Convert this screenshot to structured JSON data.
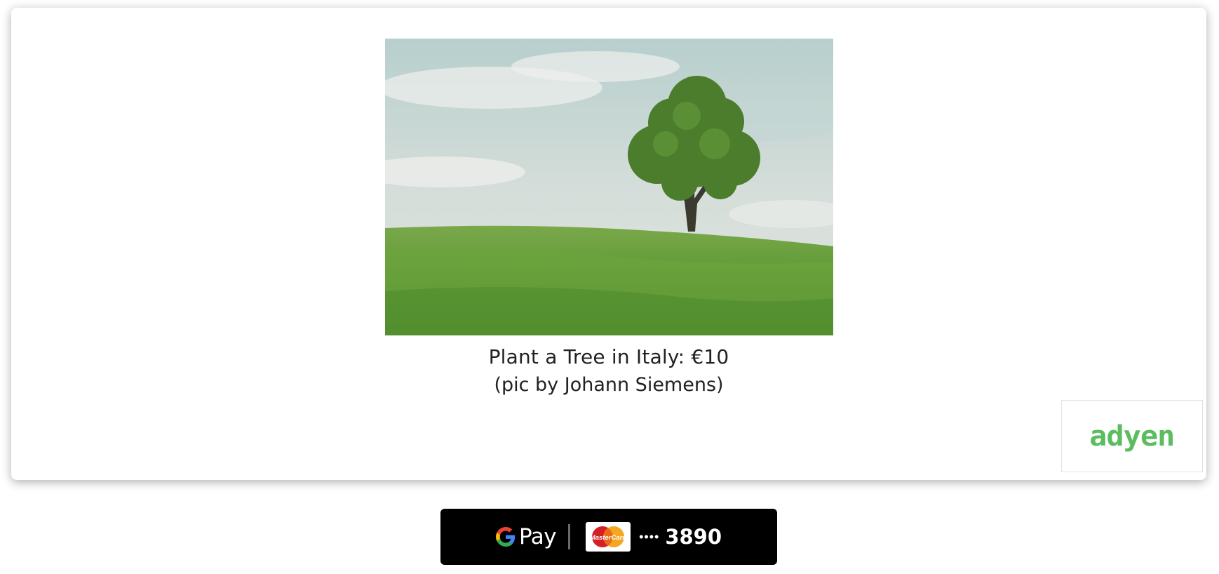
{
  "product": {
    "title": "Plant a Tree in Italy: €10",
    "credit": "(pic by Johann Siemens)",
    "image_alt": "Lone tree on a green grassy hill under a cloudy sky"
  },
  "adyen": {
    "logo_text": "adyen",
    "color": "#5cbc60"
  },
  "gpay_button": {
    "pay_label": "Pay",
    "card_brand": "MasterCard",
    "card_dots": "••••",
    "card_last4": "3890",
    "background": "#000000"
  },
  "icons": {
    "google": "google-g-icon",
    "card": "mastercard-icon"
  }
}
